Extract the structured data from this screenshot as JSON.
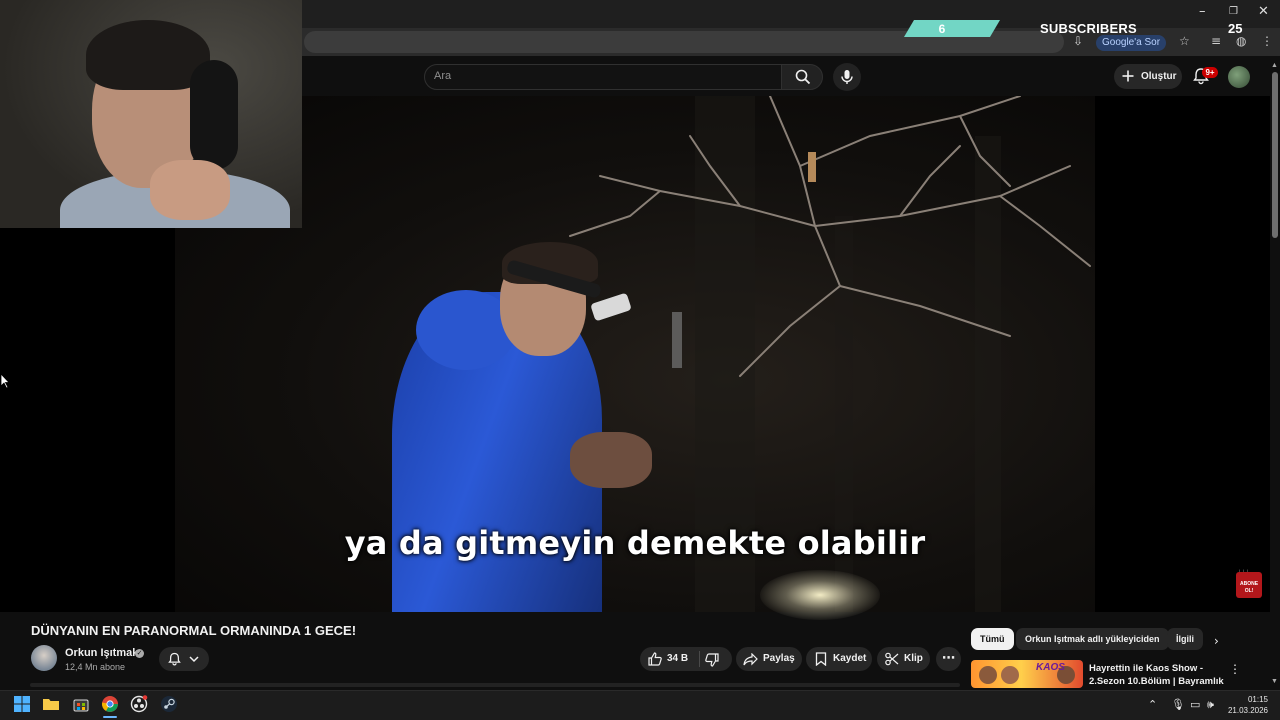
{
  "browser": {
    "google_sor_label": "Google'a Sor",
    "minimize_icon": "minimize-icon",
    "restore_icon": "restore-icon",
    "close_icon": "close-icon"
  },
  "overlay": {
    "subscribers_current": "6",
    "subscribers_label": "SUBSCRIBERS",
    "subscribers_goal": "25",
    "bar_color": "#72d6c5"
  },
  "youtube": {
    "search_placeholder": "Ara",
    "create_label": "Oluştur",
    "notifications_badge": "9+"
  },
  "video": {
    "subtitle": "ya da gitmeyin demekte olabilir",
    "title": "DÜNYANIN EN PARANORMAL ORMANINDA 1 GECE!",
    "abone_badge": "ABONE OL!"
  },
  "channel": {
    "name": "Orkun Işıtmak",
    "subscribers": "12,4 Mn abone"
  },
  "actions": {
    "likes": "34 B",
    "share": "Paylaş",
    "save": "Kaydet",
    "clip": "Klip"
  },
  "chips": [
    {
      "label": "Tümü",
      "active": true
    },
    {
      "label": "Orkun Işıtmak adlı yükleyiciden",
      "active": false
    },
    {
      "label": "İlgili",
      "active": false
    }
  ],
  "recommendation": {
    "title": "Hayrettin ile Kaos Show - 2.Sezon 10.Bölüm | Bayramlık ...",
    "thumb_text": "KAOS"
  },
  "taskbar": {
    "time": "01:15",
    "date": "21.03.2026"
  },
  "colors": {
    "accent_red": "#cc0000",
    "background": "#0f0f0f",
    "jacket_blue": "#2b59d6"
  }
}
